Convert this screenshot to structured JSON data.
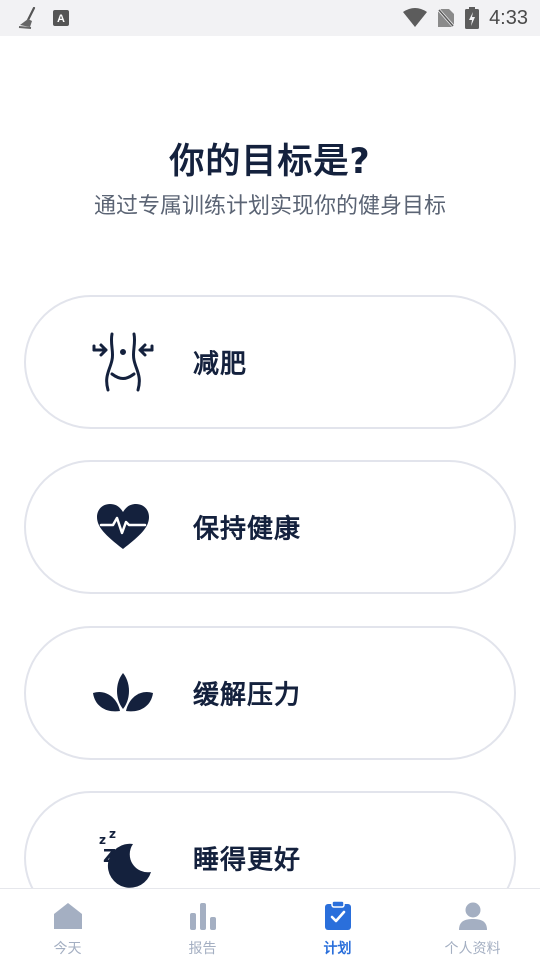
{
  "status_bar": {
    "time": "4:33",
    "icons": [
      "broom-icon",
      "a-keyboard-icon",
      "wifi-icon",
      "no-sim-icon",
      "battery-charging-icon"
    ]
  },
  "header": {
    "title": "你的目标是?",
    "subtitle": "通过专属训练计划实现你的健身目标"
  },
  "goals": [
    {
      "label": "减肥",
      "icon": "waist-slim-icon"
    },
    {
      "label": "保持健康",
      "icon": "heart-pulse-icon"
    },
    {
      "label": "缓解压力",
      "icon": "lotus-icon"
    },
    {
      "label": "睡得更好",
      "icon": "moon-sleep-icon"
    }
  ],
  "bottom_nav": {
    "items": [
      {
        "label": "今天",
        "icon": "home-icon",
        "active": false
      },
      {
        "label": "报告",
        "icon": "bar-chart-icon",
        "active": false
      },
      {
        "label": "计划",
        "icon": "clipboard-check-icon",
        "active": true
      },
      {
        "label": "个人资料",
        "icon": "user-icon",
        "active": false
      }
    ]
  },
  "colors": {
    "primary_text": "#14213d",
    "accent": "#2a6fdb",
    "nav_inactive": "#a4afc2",
    "card_border": "#e2e4ec"
  }
}
